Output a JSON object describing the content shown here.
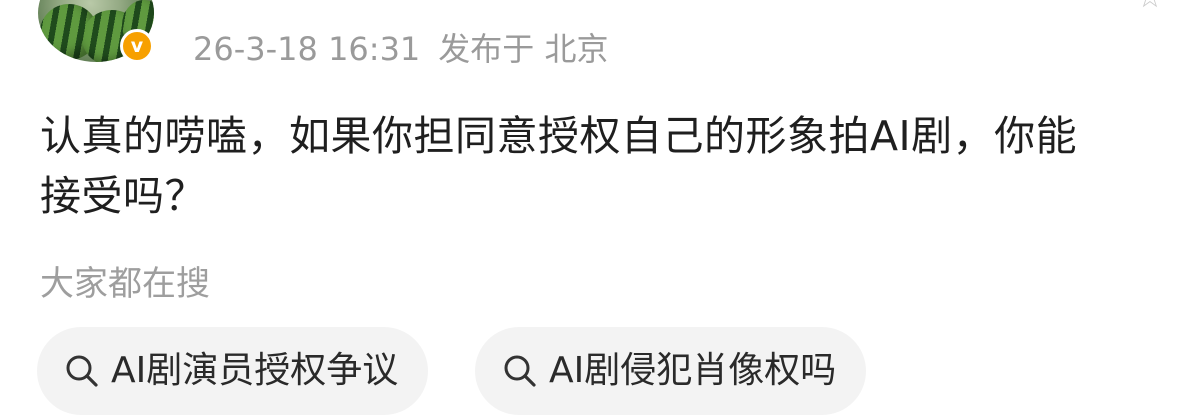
{
  "post": {
    "timestamp": "26-3-18 16:31",
    "location": "发布于 北京",
    "text": "认真的唠嗑，如果你担同意授权自己的形象拍AI剧，你能\n接受吗？"
  },
  "search_section": {
    "title": "大家都在搜",
    "chips": [
      {
        "label": "AI剧演员授权争议",
        "icon": "search-icon"
      },
      {
        "label": "AI剧侵犯肖像权吗",
        "icon": "search-icon"
      }
    ]
  },
  "colors": {
    "verified_badge": "#f7a000",
    "meta_text": "#9a9a9a",
    "chip_background": "#f3f3f3"
  }
}
